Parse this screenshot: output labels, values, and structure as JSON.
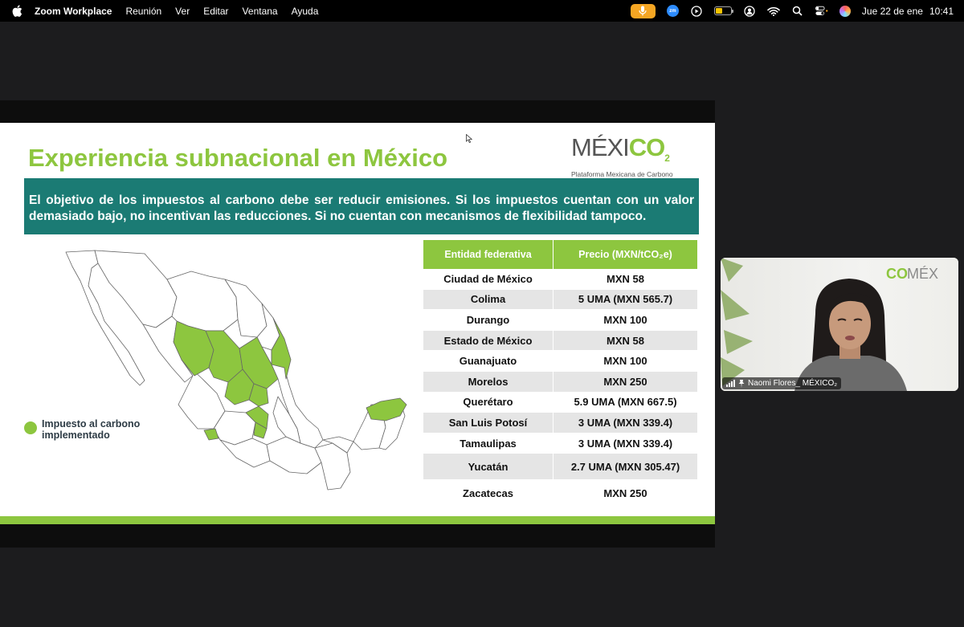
{
  "menubar": {
    "app_name": "Zoom Workplace",
    "menus": [
      "Reunión",
      "Ver",
      "Editar",
      "Ventana",
      "Ayuda"
    ],
    "date": "Jue 22 de ene",
    "time": "10:41",
    "zoom_badge": "zm",
    "icons": [
      "apple-icon",
      "microphone-icon",
      "zoom-icon",
      "play-icon",
      "battery-icon",
      "user-icon",
      "wifi-icon",
      "search-icon",
      "control-center-icon",
      "siri-icon"
    ]
  },
  "slide": {
    "title": "Experiencia subnacional en México",
    "logo_word_a": "MÉXI",
    "logo_word_b": "CO",
    "logo_word_sub": "2",
    "logo_subtitle": "Plataforma Mexicana de Carbono",
    "banner": "El objetivo de los impuestos al carbono debe ser reducir emisiones. Si los impuestos cuentan con un valor demasiado bajo, no incentivan las reducciones. Si no cuentan con mecanismos de flexibilidad tampoco.",
    "legend_label": "Impuesto al carbono implementado",
    "table": {
      "headers": [
        "Entidad federativa",
        "Precio (MXN/tCO₂e)"
      ],
      "rows": [
        [
          "Ciudad de México",
          "MXN 58"
        ],
        [
          "Colima",
          "5 UMA (MXN 565.7)"
        ],
        [
          "Durango",
          "MXN 100"
        ],
        [
          "Estado de México",
          "MXN 58"
        ],
        [
          "Guanajuato",
          "MXN 100"
        ],
        [
          "Morelos",
          "MXN 250"
        ],
        [
          "Querétaro",
          "5.9 UMA (MXN 667.5)"
        ],
        [
          "San Luis Potosí",
          "3 UMA (MXN 339.4)"
        ],
        [
          "Tamaulipas",
          "3 UMA (MXN 339.4)"
        ],
        [
          "Yucatán",
          "2.7 UMA (MXN 305.47)"
        ],
        [
          "Zacatecas",
          "MXN 250"
        ]
      ]
    }
  },
  "participant": {
    "name": "Naomi Flores_ MÉXICO₂"
  },
  "colors": {
    "accent_green": "#8dc63f",
    "banner_teal": "#1b7b74",
    "title_green": "#8dc63f"
  }
}
